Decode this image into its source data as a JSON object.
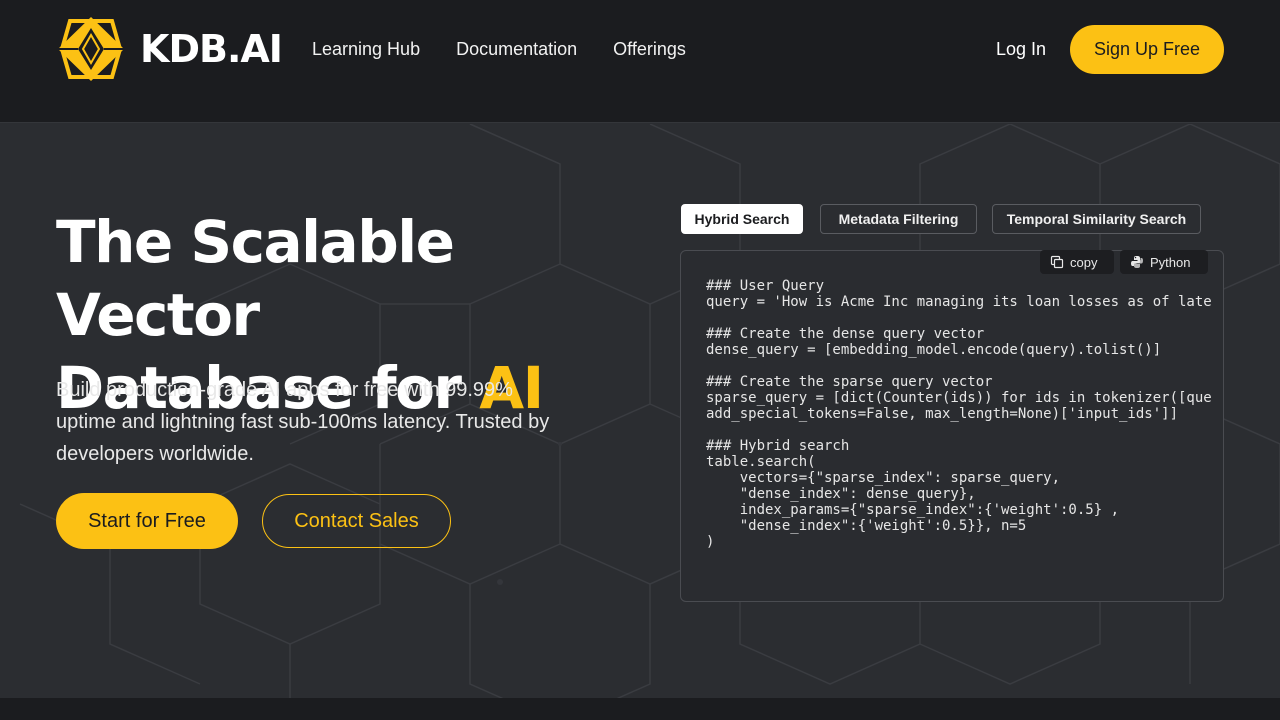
{
  "header": {
    "brand": "KDB.AI",
    "nav": [
      "Learning Hub",
      "Documentation",
      "Offerings"
    ],
    "login": "Log In",
    "signup": "Sign Up Free"
  },
  "hero": {
    "headline_line1": "The Scalable Vector",
    "headline_line2": "Database for ",
    "headline_accent": "AI",
    "subtext": "Build production-grade AI apps for free with 99.99% uptime and lightning fast sub-100ms latency. Trusted by developers worldwide.",
    "start_button": "Start for Free",
    "contact_button": "Contact Sales"
  },
  "code_tabs": {
    "tabs": [
      "Hybrid Search",
      "Metadata Filtering",
      "Temporal Similarity Search"
    ],
    "active": "Hybrid Search",
    "copy_label": "copy",
    "language_label": "Python",
    "code": "### User Query\nquery = 'How is Acme Inc managing its loan losses as of late\n\n### Create the dense query vector\ndense_query = [embedding_model.encode(query).tolist()]\n\n### Create the sparse query vector\nsparse_query = [dict(Counter(ids)) for ids in tokenizer([que\nadd_special_tokens=False, max_length=None)['input_ids']]\n\n### Hybrid search\ntable.search(\n    vectors={\"sparse_index\": sparse_query,\n    \"dense_index\": dense_query},\n    index_params={\"sparse_index\":{'weight':0.5} ,\n    \"dense_index\":{'weight':0.5}}, n=5\n)"
  },
  "colors": {
    "accent": "#fcc114",
    "header_bg": "#1b1c1f",
    "hero_bg": "#2b2d31"
  }
}
